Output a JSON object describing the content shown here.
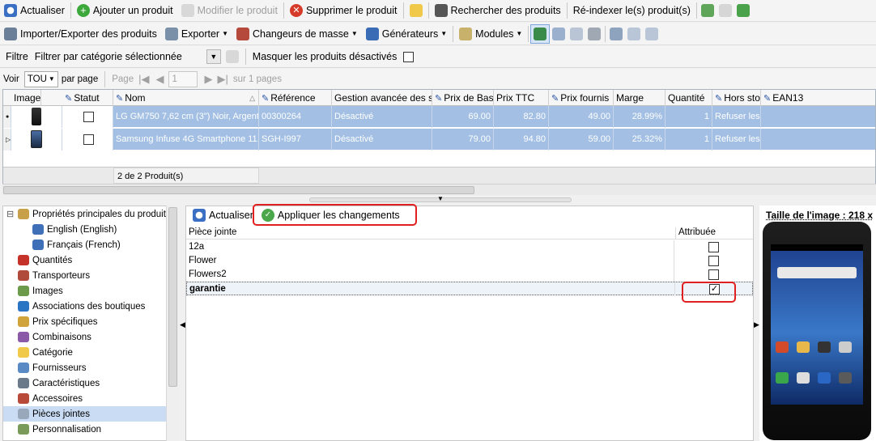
{
  "toolbar1": {
    "refresh": "Actualiser",
    "add": "Ajouter un produit",
    "edit": "Modifier le produit",
    "delete": "Supprimer le produit",
    "search": "Rechercher des produits",
    "reindex": "Ré-indexer le(s) produit(s)"
  },
  "toolbar2": {
    "import_export": "Importer/Exporter des produits",
    "export": "Exporter",
    "mass_change": "Changeurs de masse",
    "generators": "Générateurs",
    "modules": "Modules"
  },
  "filter": {
    "label": "Filtre",
    "value": "Filtrer par catégorie sélectionnée",
    "hide_label": "Masquer les produits désactivés"
  },
  "pager": {
    "view": "Voir",
    "per_page_value": "TOU",
    "per_page": "par page",
    "page": "Page",
    "page_value": "1",
    "of_pages": "sur 1 pages"
  },
  "grid": {
    "columns": [
      "Image",
      "Statut",
      "Nom",
      "Référence",
      "Gestion avancée des sto",
      "Prix de Base",
      "Prix TTC",
      "Prix fournis",
      "Marge",
      "Quantité",
      "Hors sto",
      "EAN13"
    ],
    "rows": [
      {
        "name": "LG GM750 7,62 cm (3\") Noir, Argent",
        "ref": "00300264",
        "stock_mgmt": "Désactivé",
        "base_price": "69.00",
        "price_ttc": "82.80",
        "supplier_price": "49.00",
        "margin": "28.99%",
        "qty": "1",
        "out_stock": "Refuser les"
      },
      {
        "name": "Samsung Infuse 4G Smartphone 11,4",
        "ref": "SGH-I997",
        "stock_mgmt": "Désactivé",
        "base_price": "79.00",
        "price_ttc": "94.80",
        "supplier_price": "59.00",
        "margin": "25.32%",
        "qty": "1",
        "out_stock": "Refuser les"
      }
    ],
    "footer": "2 de 2 Produit(s)"
  },
  "tree": {
    "items": [
      {
        "label": "Propriétés principales du produit",
        "icon": "box-icon"
      },
      {
        "label": "English (English)",
        "icon": "flag-us-icon"
      },
      {
        "label": "Français (French)",
        "icon": "flag-fr-icon"
      },
      {
        "label": "Quantités",
        "icon": "123-icon"
      },
      {
        "label": "Transporteurs",
        "icon": "truck-icon"
      },
      {
        "label": "Images",
        "icon": "image-icon"
      },
      {
        "label": "Associations des boutiques",
        "icon": "globe-icon"
      },
      {
        "label": "Prix spécifiques",
        "icon": "price-tag-icon"
      },
      {
        "label": "Combinaisons",
        "icon": "combinations-icon"
      },
      {
        "label": "Catégorie",
        "icon": "folder-icon"
      },
      {
        "label": "Fournisseurs",
        "icon": "supplier-icon"
      },
      {
        "label": "Caractéristiques",
        "icon": "features-icon"
      },
      {
        "label": "Accessoires",
        "icon": "accessories-icon"
      },
      {
        "label": "Pièces jointes",
        "icon": "paperclip-icon"
      },
      {
        "label": "Personnalisation",
        "icon": "customization-icon"
      }
    ]
  },
  "attachments": {
    "refresh": "Actualiser",
    "apply": "Appliquer les changements",
    "col_name": "Pièce jointe",
    "col_assigned": "Attribuée",
    "rows": [
      {
        "name": "12a",
        "assigned": false
      },
      {
        "name": "Flower",
        "assigned": false
      },
      {
        "name": "Flowers2",
        "assigned": false
      },
      {
        "name": "garantie",
        "assigned": true
      }
    ]
  },
  "image_panel": {
    "title": "Taille de l'image : 218 x"
  },
  "colors": {
    "row_selected": "#a3c0e4",
    "tree_selected": "#c9dcf3",
    "highlight": "#e02020",
    "accent": "#2b56a8"
  }
}
